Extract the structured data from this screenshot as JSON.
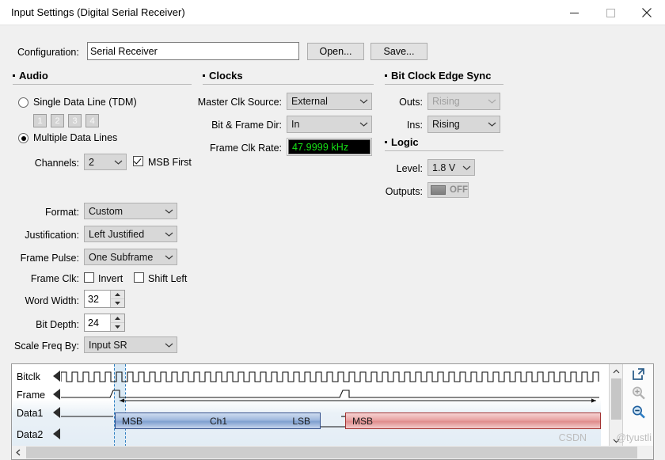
{
  "window": {
    "title": "Input Settings (Digital Serial Receiver)",
    "minimize_icon": "minimize-icon",
    "maximize_icon": "maximize-icon",
    "close_icon": "close-icon"
  },
  "config": {
    "label": "Configuration:",
    "value": "Serial Receiver",
    "placeholder": "",
    "open_button": "Open...",
    "save_button": "Save..."
  },
  "audio": {
    "section_title": "Audio",
    "single_data_line_label": "Single Data Line (TDM)",
    "single_data_line_selected": false,
    "tdm_buttons": [
      "1",
      "2",
      "3",
      "4"
    ],
    "multiple_data_lines_label": "Multiple Data Lines",
    "multiple_data_lines_selected": true,
    "channels_label": "Channels:",
    "channels_value": "2",
    "msb_first_label": "MSB First",
    "msb_first_checked": true,
    "format_label": "Format:",
    "format_value": "Custom",
    "justification_label": "Justification:",
    "justification_value": "Left Justified",
    "frame_pulse_label": "Frame Pulse:",
    "frame_pulse_value": "One Subframe",
    "frame_clk_label": "Frame Clk:",
    "invert_label": "Invert",
    "invert_checked": false,
    "shift_left_label": "Shift Left",
    "shift_left_checked": false,
    "word_width_label": "Word Width:",
    "word_width_value": "32",
    "bit_depth_label": "Bit Depth:",
    "bit_depth_value": "24",
    "scale_freq_label": "Scale Freq By:",
    "scale_freq_value": "Input SR"
  },
  "clocks": {
    "section_title": "Clocks",
    "master_clk_source_label": "Master Clk Source:",
    "master_clk_source_value": "External",
    "bit_frame_dir_label": "Bit & Frame Dir:",
    "bit_frame_dir_value": "In",
    "frame_clk_rate_label": "Frame Clk Rate:",
    "frame_clk_rate_value": "47.9999 kHz",
    "frame_clk_rate_color": "#16e016"
  },
  "bit_clock_edge_sync": {
    "section_title": "Bit Clock Edge Sync",
    "outs_label": "Outs:",
    "outs_value": "Rising",
    "outs_disabled": true,
    "ins_label": "Ins:",
    "ins_value": "Rising",
    "ins_disabled": false
  },
  "logic": {
    "section_title": "Logic",
    "level_label": "Level:",
    "level_value": "1.8 V",
    "outputs_label": "Outputs:",
    "outputs_toggle_state": "OFF"
  },
  "waveform": {
    "rows": [
      "Bitclk",
      "Frame",
      "Data1",
      "Data2"
    ],
    "data1_bar_labels": {
      "left": "MSB",
      "center": "Ch1",
      "right": "LSB"
    },
    "data2_bar_labels": {
      "left": "MSB"
    },
    "expand_icon": "expand-icon",
    "zoom_in_icon": "zoom-in-icon",
    "zoom_out_icon": "zoom-out-icon",
    "zoom_in_disabled": true,
    "zoom_out_disabled": false,
    "scroll_left_icon": "chevron-left-icon",
    "scroll_up_icon": "chevron-up-icon",
    "scroll_down_icon": "chevron-down-icon"
  },
  "watermark": {
    "text": "CSDN @tyustli"
  }
}
